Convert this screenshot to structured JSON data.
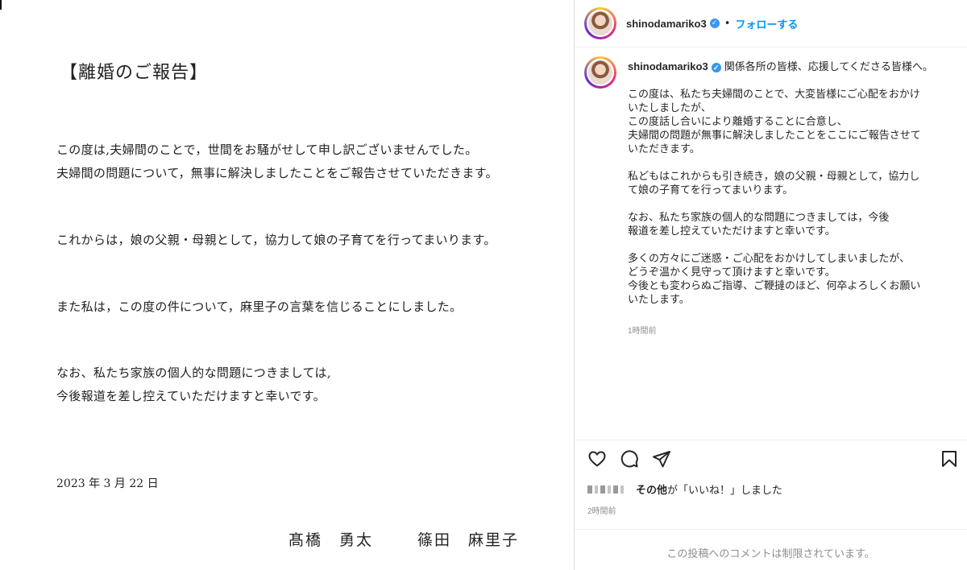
{
  "document": {
    "title": "【離婚のご報告】",
    "paragraphs": [
      [
        "この度は,夫婦間のことで，世間をお騒がせして申し訳ございませんでした。",
        "夫婦間の問題について，無事に解決しましたことをご報告させていただきます。"
      ],
      [
        "これからは，娘の父親・母親として，協力して娘の子育てを行ってまいります。"
      ],
      [
        "また私は，この度の件について，麻里子の言葉を信じることにしました。"
      ],
      [
        "なお、私たち家族の個人的な問題につきましては,",
        "今後報道を差し控えていただけますと幸いです。"
      ]
    ],
    "date": "2023 年 3 月 22 日",
    "signatures": [
      "髙橋　勇太",
      "篠田　麻里子"
    ]
  },
  "post": {
    "username": "shinodamariko3",
    "separator": "•",
    "follow_label": "フォローする",
    "caption_head": "関係各所の皆様、応援してくださる皆様へ。",
    "caption_body": "この度は、私たち夫婦間のことで、大変皆様にご心配をおかけ\nいたしましたが、\nこの度話し合いにより離婚することに合意し、\n夫婦間の問題が無事に解決しましたことをここにご報告させて\nいただきます。\n\n私どもはこれからも引き続き，娘の父親・母親として，協力し\nて娘の子育てを行ってまいります。\n\nなお、私たち家族の個人的な問題につきましては，今後\n報道を差し控えていただけますと幸いです。\n\n多くの方々にご迷惑・ご心配をおかけしてしまいましたが、\nどうぞ温かく見守って頂けますと幸いです。\n今後とも変わらぬご指導、ご鞭撻のほど、何卒よろしくお願い\nいたします。",
    "caption_time": "1時間前",
    "likes_others": "その他",
    "likes_suffix": "が「いいね！」しました",
    "likes_time": "2時間前",
    "comments_limited": "この投稿へのコメントは制限されています。"
  },
  "icons": {
    "verified": "verified-badge-icon",
    "like": "heart-icon",
    "comment": "comment-icon",
    "share": "share-icon",
    "save": "bookmark-icon"
  },
  "colors": {
    "link": "#0095f6",
    "verified": "#3897f0",
    "muted": "#8e8e8e"
  }
}
